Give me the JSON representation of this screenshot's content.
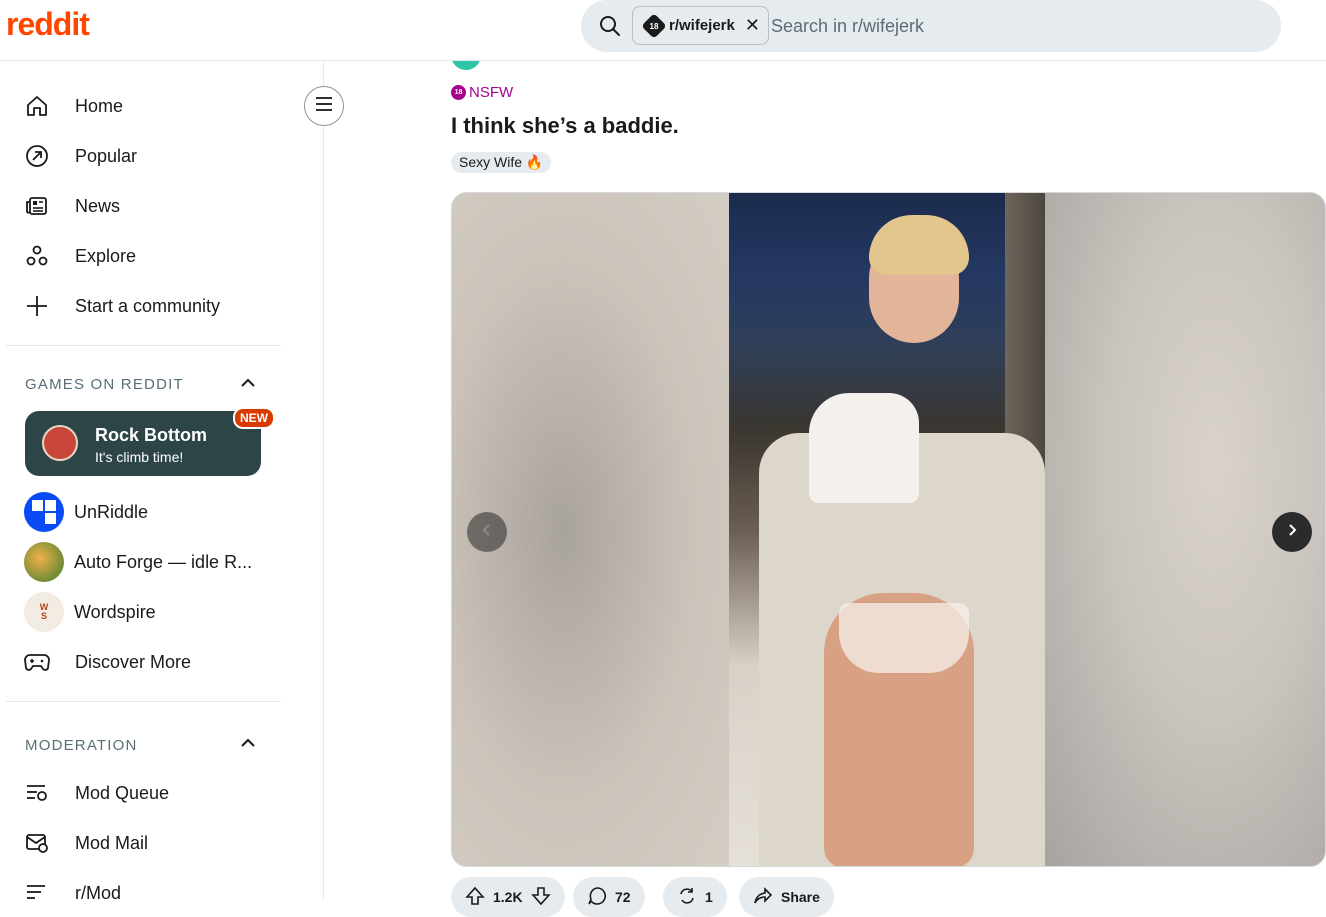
{
  "header": {
    "logo": "reddit",
    "search": {
      "chip_label": "r/wifejerk",
      "chip_badge": "18",
      "placeholder": "Search in r/wifejerk"
    }
  },
  "sidebar": {
    "nav": [
      {
        "label": "Home",
        "icon": "home-icon"
      },
      {
        "label": "Popular",
        "icon": "popular-icon"
      },
      {
        "label": "News",
        "icon": "news-icon"
      },
      {
        "label": "Explore",
        "icon": "explore-icon"
      },
      {
        "label": "Start a community",
        "icon": "plus-icon"
      }
    ],
    "games_section": {
      "title": "GAMES ON REDDIT",
      "featured": {
        "title": "Rock Bottom",
        "subtitle": "It's climb time!",
        "badge": "NEW"
      },
      "items": [
        {
          "label": "UnRiddle",
          "icon": "unriddle-icon",
          "color": "#0a4bf5"
        },
        {
          "label": "Auto Forge — idle R...",
          "icon": "auto-forge-icon",
          "color": "#e1863b"
        },
        {
          "label": "Wordspire",
          "icon": "wordspire-icon",
          "color": "#f3ece3"
        },
        {
          "label": "Discover More",
          "icon": "controller-icon"
        }
      ]
    },
    "moderation_section": {
      "title": "MODERATION",
      "items": [
        {
          "label": "Mod Queue",
          "icon": "mod-queue-icon"
        },
        {
          "label": "Mod Mail",
          "icon": "mod-mail-icon"
        },
        {
          "label": "r/Mod",
          "icon": "r-mod-icon"
        }
      ]
    }
  },
  "post": {
    "nsfw_badge": "18",
    "nsfw_label": "NSFW",
    "title": "I think she’s a baddie.",
    "flair": "Sexy Wife 🔥",
    "actions": {
      "upvotes": "1.2K",
      "comments": "72",
      "crossposts": "1",
      "share": "Share"
    }
  },
  "colors": {
    "brand": "#ff4500",
    "nsfw": "#a4028d",
    "game_card": "#2d4547",
    "new_badge": "#d93a00"
  }
}
